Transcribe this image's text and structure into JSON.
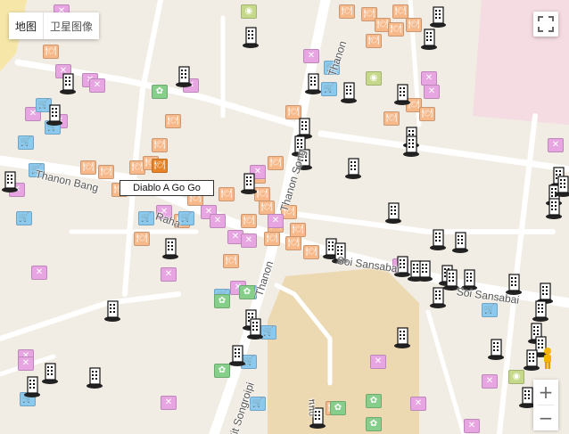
{
  "map_type": {
    "map_label": "地图",
    "satellite_label": "卫星图像"
  },
  "place_label": "Diablo A Go Go",
  "streets": {
    "thanon_bang": "Thanon Bang",
    "thanon_songwat": "Thanon Song",
    "thanon_north": "Thanon",
    "soi_sansabai_1": "Soi Sansabai",
    "soi_sansabai_2": "Soi Sansabai",
    "sit_songroipi": "Sit Songroipi",
    "thanon_lower": "Thanon",
    "lower_fragment": "ถนน",
    "raha": "Raha"
  },
  "controls": {
    "zoom_in": "+",
    "zoom_out": "−",
    "fullscreen": "⛶"
  },
  "poi_icons": {
    "food": "restaurant-icon",
    "bar": "cocktail-icon",
    "shop": "shopping-cart-icon",
    "park": "park-icon",
    "photo": "camera-icon",
    "building": "hotel-building-icon"
  },
  "colors": {
    "land": "#f2ede4",
    "road": "#ffffff",
    "beach": "#f6e7a8",
    "pink_block": "#f5dbe2",
    "green": "#cde6c0"
  }
}
